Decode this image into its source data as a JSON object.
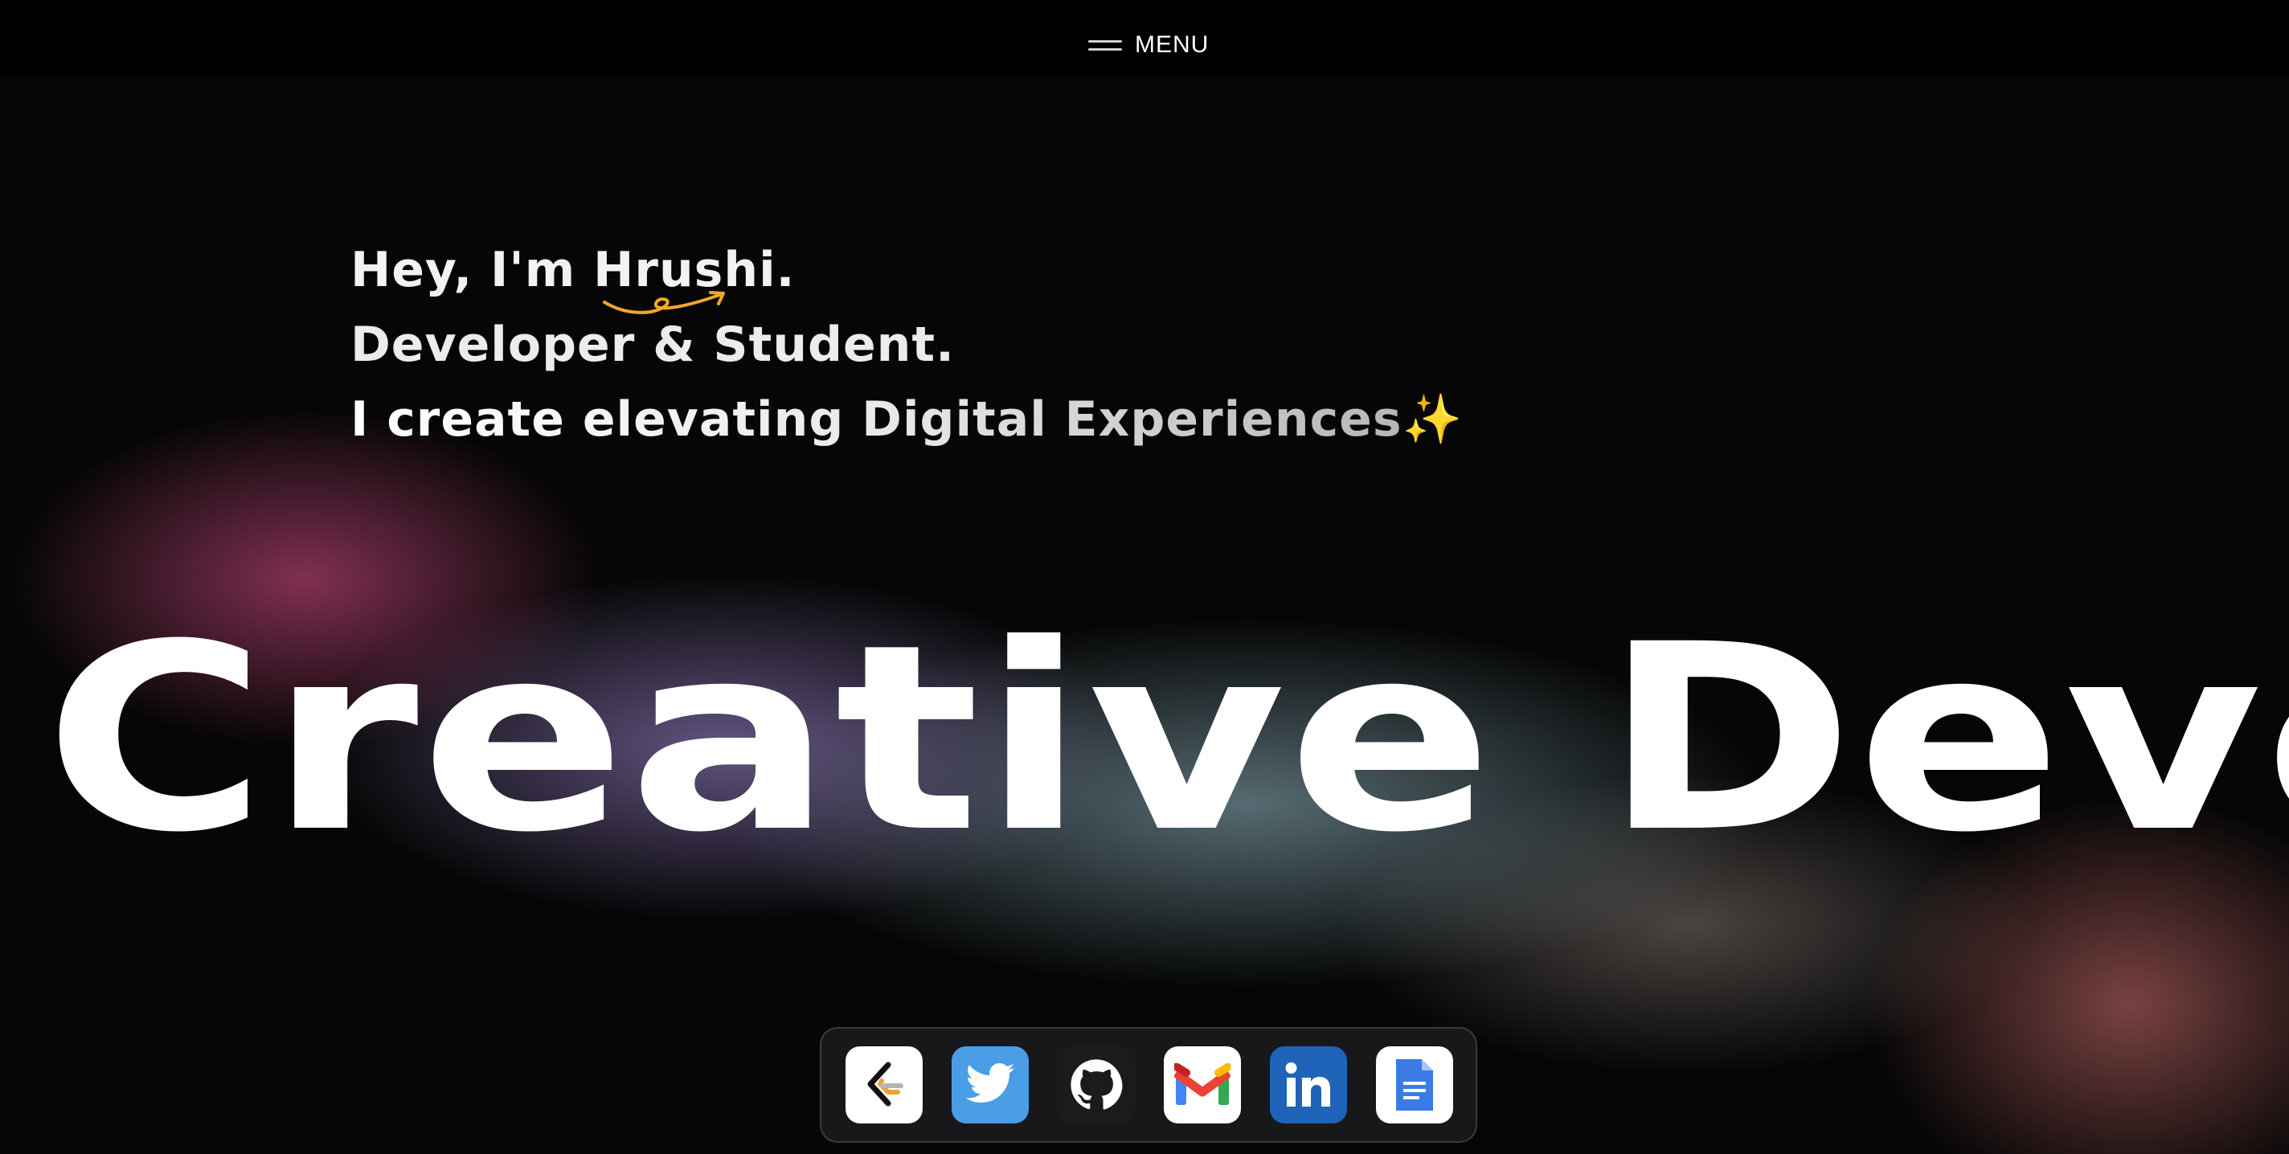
{
  "header": {
    "menu_label": "MENU"
  },
  "intro": {
    "line1_prefix": "Hey, I'm ",
    "line1_name": "Hrushi",
    "line1_suffix": ".",
    "line2": "Developer & Student.",
    "line3": "I create elevating Digital Experiences",
    "line3_emoji": "✨"
  },
  "hero": {
    "title": "Creative Developer"
  },
  "dock": {
    "items": [
      {
        "icon": "leetcode-icon"
      },
      {
        "icon": "twitter-icon"
      },
      {
        "icon": "github-icon"
      },
      {
        "icon": "gmail-icon"
      },
      {
        "icon": "linkedin-icon"
      },
      {
        "icon": "google-docs-icon"
      }
    ]
  },
  "colors": {
    "background": "#000000",
    "accent_arrow": "#f0a72a",
    "twitter": "#4a9ee6",
    "linkedin": "#1f64b8",
    "docs": "#3a7be6"
  }
}
